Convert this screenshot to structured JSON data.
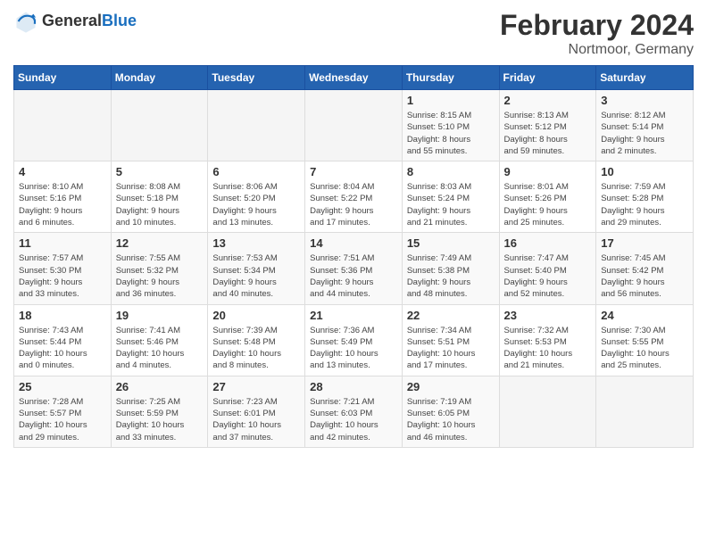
{
  "header": {
    "logo_general": "General",
    "logo_blue": "Blue",
    "month_title": "February 2024",
    "location": "Nortmoor, Germany"
  },
  "weekdays": [
    "Sunday",
    "Monday",
    "Tuesday",
    "Wednesday",
    "Thursday",
    "Friday",
    "Saturday"
  ],
  "rows": [
    [
      {
        "day": "",
        "info": ""
      },
      {
        "day": "",
        "info": ""
      },
      {
        "day": "",
        "info": ""
      },
      {
        "day": "",
        "info": ""
      },
      {
        "day": "1",
        "info": "Sunrise: 8:15 AM\nSunset: 5:10 PM\nDaylight: 8 hours\nand 55 minutes."
      },
      {
        "day": "2",
        "info": "Sunrise: 8:13 AM\nSunset: 5:12 PM\nDaylight: 8 hours\nand 59 minutes."
      },
      {
        "day": "3",
        "info": "Sunrise: 8:12 AM\nSunset: 5:14 PM\nDaylight: 9 hours\nand 2 minutes."
      }
    ],
    [
      {
        "day": "4",
        "info": "Sunrise: 8:10 AM\nSunset: 5:16 PM\nDaylight: 9 hours\nand 6 minutes."
      },
      {
        "day": "5",
        "info": "Sunrise: 8:08 AM\nSunset: 5:18 PM\nDaylight: 9 hours\nand 10 minutes."
      },
      {
        "day": "6",
        "info": "Sunrise: 8:06 AM\nSunset: 5:20 PM\nDaylight: 9 hours\nand 13 minutes."
      },
      {
        "day": "7",
        "info": "Sunrise: 8:04 AM\nSunset: 5:22 PM\nDaylight: 9 hours\nand 17 minutes."
      },
      {
        "day": "8",
        "info": "Sunrise: 8:03 AM\nSunset: 5:24 PM\nDaylight: 9 hours\nand 21 minutes."
      },
      {
        "day": "9",
        "info": "Sunrise: 8:01 AM\nSunset: 5:26 PM\nDaylight: 9 hours\nand 25 minutes."
      },
      {
        "day": "10",
        "info": "Sunrise: 7:59 AM\nSunset: 5:28 PM\nDaylight: 9 hours\nand 29 minutes."
      }
    ],
    [
      {
        "day": "11",
        "info": "Sunrise: 7:57 AM\nSunset: 5:30 PM\nDaylight: 9 hours\nand 33 minutes."
      },
      {
        "day": "12",
        "info": "Sunrise: 7:55 AM\nSunset: 5:32 PM\nDaylight: 9 hours\nand 36 minutes."
      },
      {
        "day": "13",
        "info": "Sunrise: 7:53 AM\nSunset: 5:34 PM\nDaylight: 9 hours\nand 40 minutes."
      },
      {
        "day": "14",
        "info": "Sunrise: 7:51 AM\nSunset: 5:36 PM\nDaylight: 9 hours\nand 44 minutes."
      },
      {
        "day": "15",
        "info": "Sunrise: 7:49 AM\nSunset: 5:38 PM\nDaylight: 9 hours\nand 48 minutes."
      },
      {
        "day": "16",
        "info": "Sunrise: 7:47 AM\nSunset: 5:40 PM\nDaylight: 9 hours\nand 52 minutes."
      },
      {
        "day": "17",
        "info": "Sunrise: 7:45 AM\nSunset: 5:42 PM\nDaylight: 9 hours\nand 56 minutes."
      }
    ],
    [
      {
        "day": "18",
        "info": "Sunrise: 7:43 AM\nSunset: 5:44 PM\nDaylight: 10 hours\nand 0 minutes."
      },
      {
        "day": "19",
        "info": "Sunrise: 7:41 AM\nSunset: 5:46 PM\nDaylight: 10 hours\nand 4 minutes."
      },
      {
        "day": "20",
        "info": "Sunrise: 7:39 AM\nSunset: 5:48 PM\nDaylight: 10 hours\nand 8 minutes."
      },
      {
        "day": "21",
        "info": "Sunrise: 7:36 AM\nSunset: 5:49 PM\nDaylight: 10 hours\nand 13 minutes."
      },
      {
        "day": "22",
        "info": "Sunrise: 7:34 AM\nSunset: 5:51 PM\nDaylight: 10 hours\nand 17 minutes."
      },
      {
        "day": "23",
        "info": "Sunrise: 7:32 AM\nSunset: 5:53 PM\nDaylight: 10 hours\nand 21 minutes."
      },
      {
        "day": "24",
        "info": "Sunrise: 7:30 AM\nSunset: 5:55 PM\nDaylight: 10 hours\nand 25 minutes."
      }
    ],
    [
      {
        "day": "25",
        "info": "Sunrise: 7:28 AM\nSunset: 5:57 PM\nDaylight: 10 hours\nand 29 minutes."
      },
      {
        "day": "26",
        "info": "Sunrise: 7:25 AM\nSunset: 5:59 PM\nDaylight: 10 hours\nand 33 minutes."
      },
      {
        "day": "27",
        "info": "Sunrise: 7:23 AM\nSunset: 6:01 PM\nDaylight: 10 hours\nand 37 minutes."
      },
      {
        "day": "28",
        "info": "Sunrise: 7:21 AM\nSunset: 6:03 PM\nDaylight: 10 hours\nand 42 minutes."
      },
      {
        "day": "29",
        "info": "Sunrise: 7:19 AM\nSunset: 6:05 PM\nDaylight: 10 hours\nand 46 minutes."
      },
      {
        "day": "",
        "info": ""
      },
      {
        "day": "",
        "info": ""
      }
    ]
  ]
}
